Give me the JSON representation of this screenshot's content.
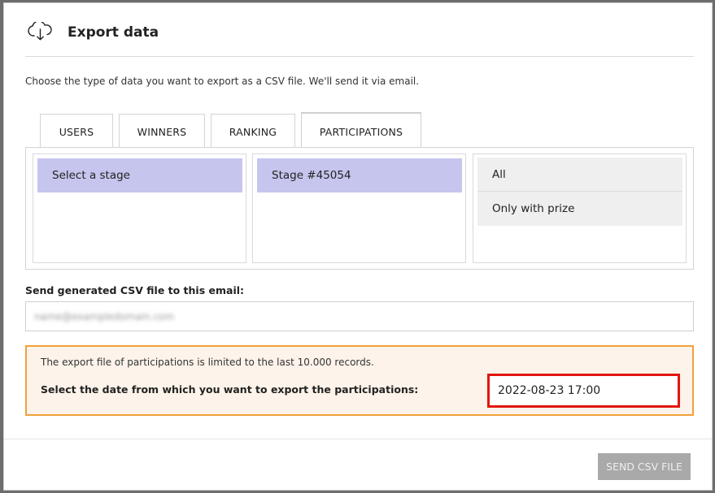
{
  "dialog": {
    "title": "Export data",
    "icon": "cloud-download-icon",
    "description": "Choose the type of data you want to export as a CSV file. We'll send it via email."
  },
  "tabs": [
    {
      "label": "USERS",
      "active": false
    },
    {
      "label": "WINNERS",
      "active": false
    },
    {
      "label": "RANKING",
      "active": false
    },
    {
      "label": "PARTICIPATIONS",
      "active": true
    }
  ],
  "selectors": {
    "stage_list": [
      "Select a stage"
    ],
    "stage_selected": "Select a stage",
    "stage_item_list": [
      "Stage #45054"
    ],
    "stage_item_selected": "Stage #45054",
    "filter_options": [
      "All",
      "Only with prize"
    ]
  },
  "email": {
    "label": "Send generated CSV file to this email:",
    "value": "name@exampledomain.com"
  },
  "notice": {
    "limit_text": "The export file of participations is limited to the last 10.000 records.",
    "date_label": "Select the date from which you want to export the participations:",
    "date_value": "2022-08-23 17:00"
  },
  "footer": {
    "send_label": "SEND CSV FILE"
  },
  "colors": {
    "selected_bg": "#c5c5ee",
    "notice_border": "#f0a23a",
    "notice_bg": "#fdf3ea",
    "highlight_border": "#e3140f",
    "button_disabled": "#a9a9a9"
  }
}
